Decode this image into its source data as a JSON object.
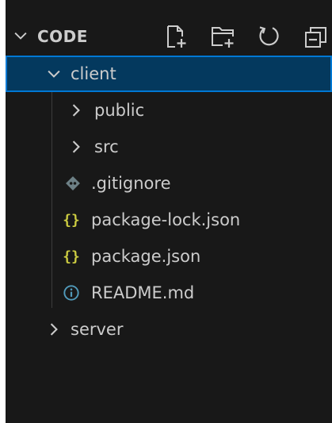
{
  "explorer": {
    "section_title": "CODE",
    "actions": [
      {
        "name": "new-file-icon"
      },
      {
        "name": "new-folder-icon"
      },
      {
        "name": "refresh-icon"
      },
      {
        "name": "collapse-all-icon"
      }
    ]
  },
  "tree": {
    "client": {
      "label": "client",
      "expanded": true,
      "selected": true
    },
    "public": {
      "label": "public",
      "expanded": false
    },
    "src": {
      "label": "src",
      "expanded": false
    },
    "gitignore": {
      "label": ".gitignore",
      "icon": "git-icon",
      "icon_color": "#6d8086"
    },
    "package_lock": {
      "label": "package-lock.json",
      "icon": "json-braces-icon",
      "icon_color": "#cbcb41"
    },
    "package": {
      "label": "package.json",
      "icon": "json-braces-icon",
      "icon_color": "#cbcb41"
    },
    "readme": {
      "label": "README.md",
      "icon": "info-icon",
      "icon_color": "#519aba"
    },
    "server": {
      "label": "server",
      "expanded": false
    }
  },
  "colors": {
    "background": "#181818",
    "text": "#cccccc",
    "selection_bg": "#04395e",
    "selection_border": "#0078d4"
  }
}
